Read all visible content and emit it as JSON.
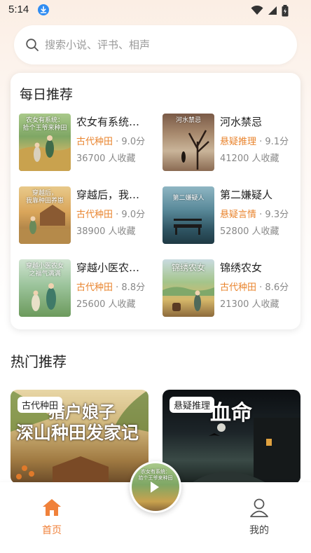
{
  "status": {
    "time": "5:14"
  },
  "search": {
    "placeholder": "搜索小说、评书、相声"
  },
  "daily": {
    "title": "每日推荐",
    "books": [
      {
        "title": "农女有系统…",
        "genre": "古代种田",
        "rating": " · 9.0分",
        "favorites": "36700 人收藏",
        "cover_text": "农女有系统：\n拾个王爷来种田"
      },
      {
        "title": "河水禁忌",
        "genre": "悬疑推理",
        "rating": " · 9.1分",
        "favorites": "41200 人收藏",
        "cover_text": "河水禁忌"
      },
      {
        "title": "穿越后，我…",
        "genre": "古代种田",
        "rating": " · 9.0分",
        "favorites": "38900 人收藏",
        "cover_text": "穿越后，\n我靠种田养崽"
      },
      {
        "title": "第二嫌疑人",
        "genre": "悬疑言情",
        "rating": " · 9.3分",
        "favorites": "52800 人收藏",
        "cover_text": "第二嫌疑人"
      },
      {
        "title": "穿越小医农…",
        "genre": "古代种田",
        "rating": " · 8.8分",
        "favorites": "25600 人收藏",
        "cover_text": "穿越小医农女\n之福气满满"
      },
      {
        "title": "锦绣农女",
        "genre": "古代种田",
        "rating": " · 8.6分",
        "favorites": "21300 人收藏",
        "cover_text": "锦绣农女"
      }
    ]
  },
  "hot": {
    "title": "热门推荐",
    "cards": [
      {
        "tag": "古代种田",
        "headline_1": "猎户娘子",
        "headline_2": "深山种田发家记"
      },
      {
        "tag": "悬疑推理",
        "headline_1": "血命",
        "headline_2": ""
      }
    ]
  },
  "nav": {
    "home_label": "首页",
    "mine_label": "我的",
    "mini_cover_text": "农女有系统：\n拾个王爷来种田"
  },
  "colors": {
    "accent": "#e9842e",
    "meta_gray": "#888888"
  }
}
